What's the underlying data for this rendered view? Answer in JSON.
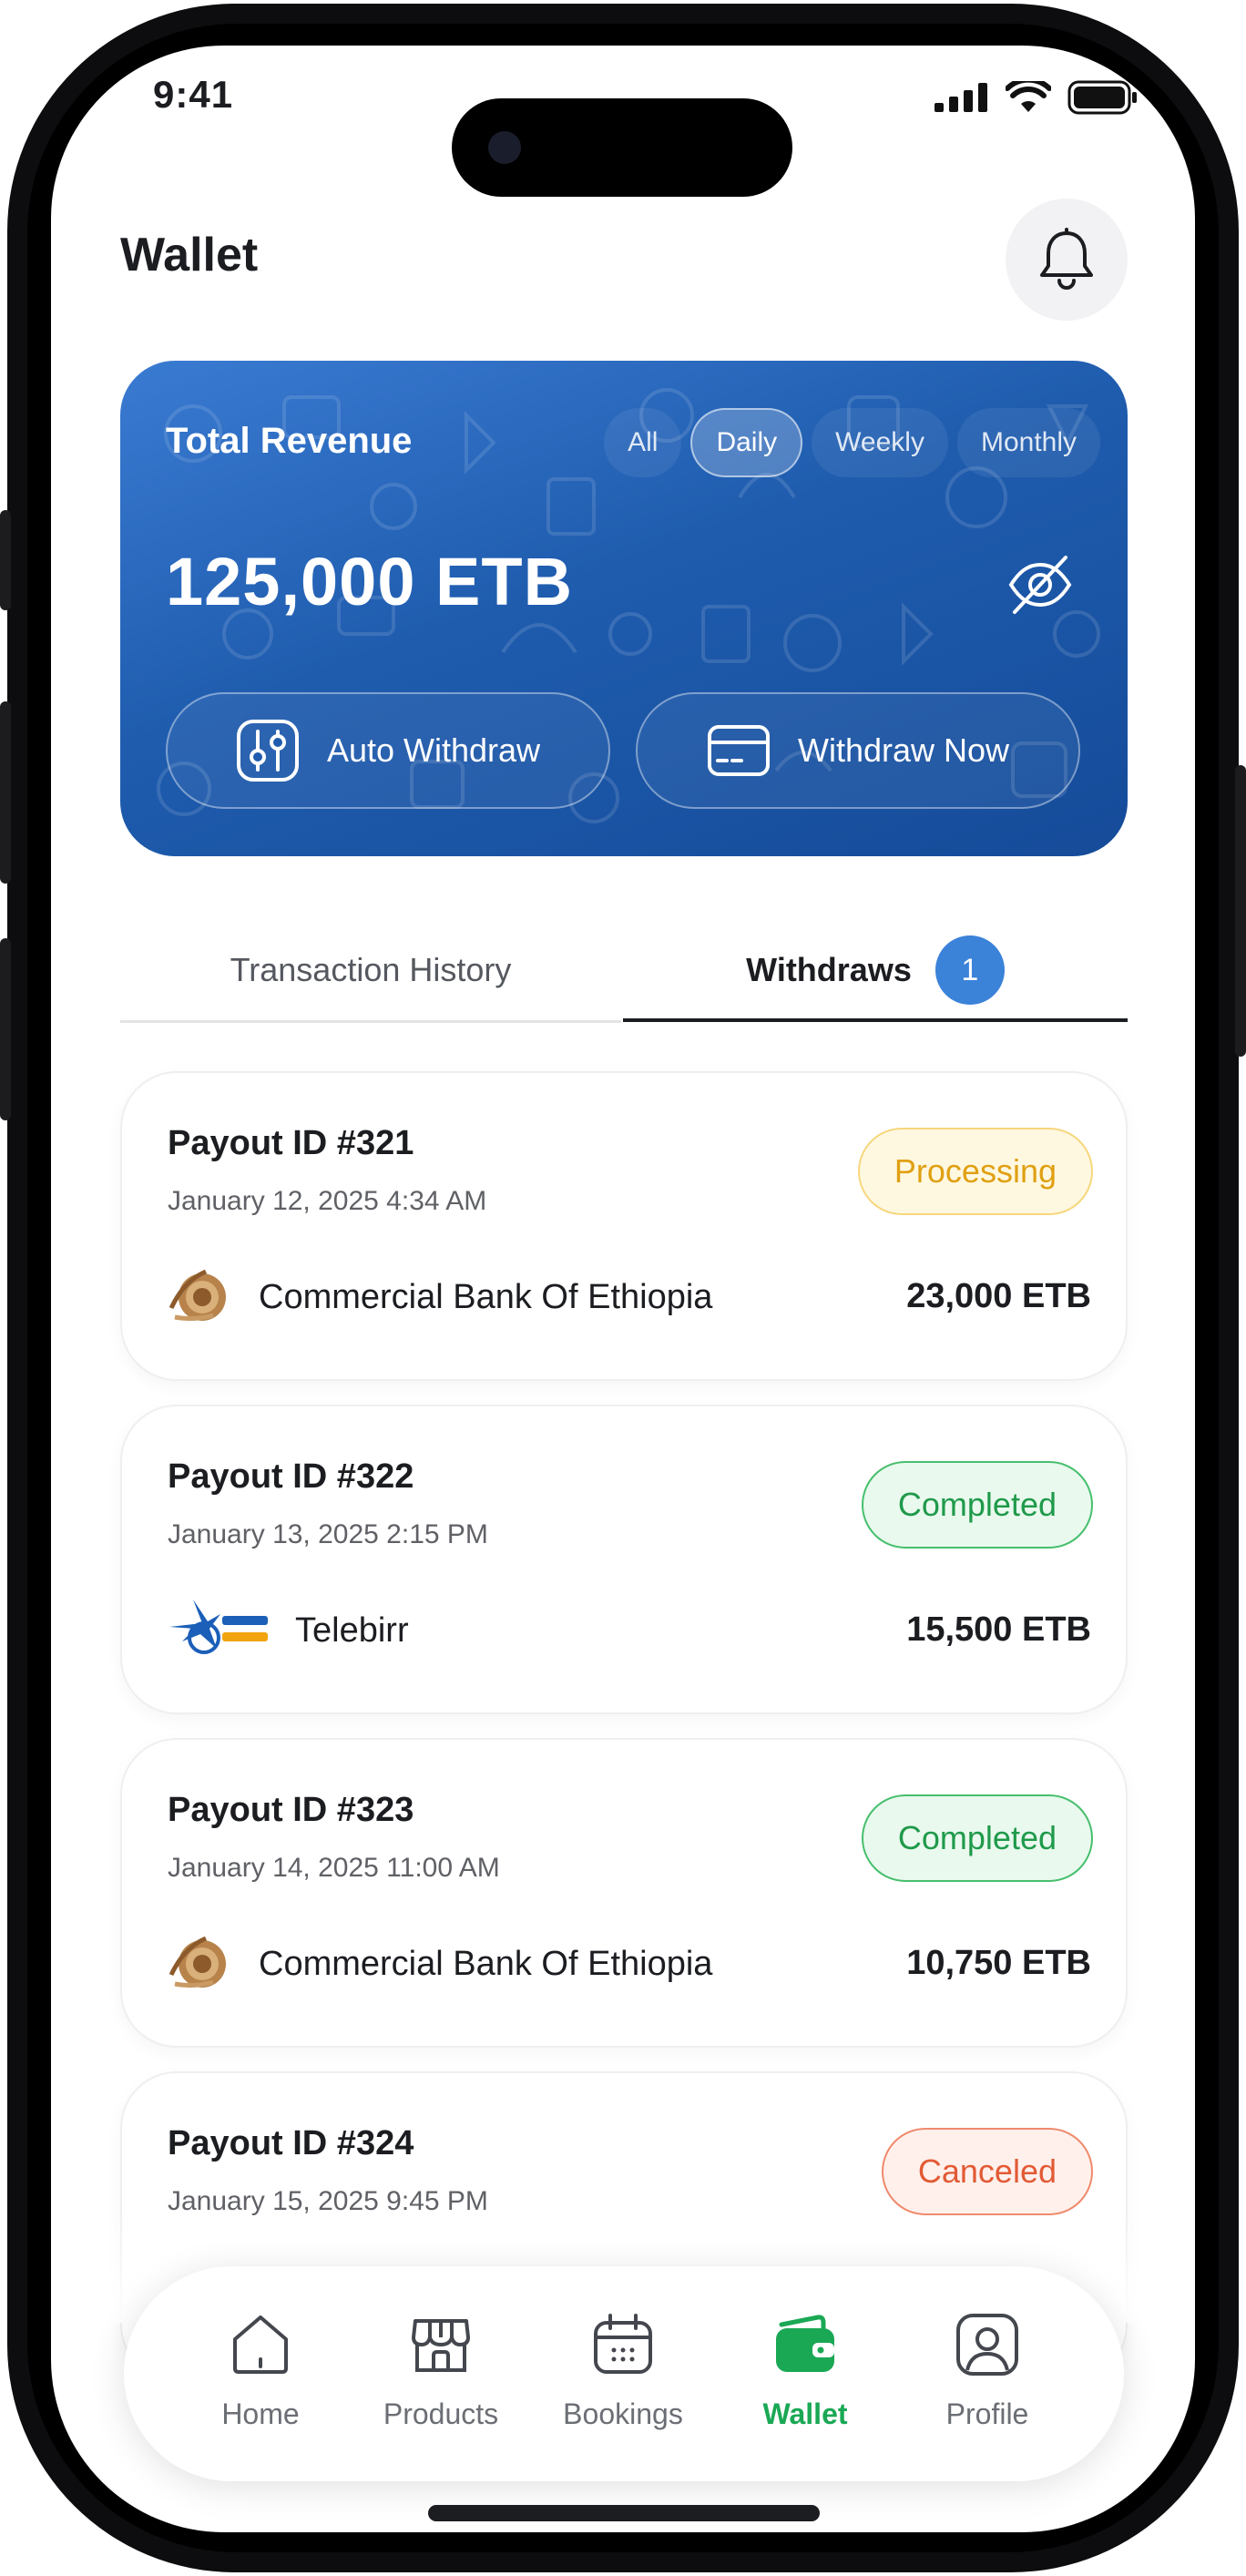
{
  "status_bar": {
    "time": "9:41"
  },
  "header": {
    "title": "Wallet"
  },
  "revenue": {
    "label": "Total Revenue",
    "periods": [
      "All",
      "Daily",
      "Weekly",
      "Monthly"
    ],
    "active_period": "Daily",
    "amount": "125,000 ETB",
    "auto_withdraw_label": "Auto Withdraw",
    "withdraw_now_label": "Withdraw Now"
  },
  "tabs": {
    "history_label": "Transaction History",
    "withdraws_label": "Withdraws",
    "withdraws_count": "1",
    "active": "Withdraws"
  },
  "payouts": [
    {
      "id": "Payout ID #321",
      "date": "January 12, 2025 4:34 AM",
      "status": "Processing",
      "status_type": "processing",
      "bank": "Commercial Bank Of Ethiopia",
      "bank_logo": "cbe-logo",
      "amount": "23,000 ETB"
    },
    {
      "id": "Payout ID #322",
      "date": "January 13, 2025 2:15 PM",
      "status": "Completed",
      "status_type": "completed",
      "bank": "Telebirr",
      "bank_logo": "telebirr-logo",
      "amount": "15,500 ETB"
    },
    {
      "id": "Payout ID #323",
      "date": "January 14, 2025 11:00 AM",
      "status": "Completed",
      "status_type": "completed",
      "bank": "Commercial Bank Of Ethiopia",
      "bank_logo": "cbe-logo",
      "amount": "10,750 ETB"
    },
    {
      "id": "Payout ID #324",
      "date": "January 15, 2025 9:45 PM",
      "status": "Canceled",
      "status_type": "canceled",
      "bank": "",
      "bank_logo": "",
      "amount": ""
    }
  ],
  "nav": {
    "items": [
      {
        "label": "Home",
        "icon": "home-icon"
      },
      {
        "label": "Products",
        "icon": "store-icon"
      },
      {
        "label": "Bookings",
        "icon": "calendar-icon"
      },
      {
        "label": "Wallet",
        "icon": "wallet-icon"
      },
      {
        "label": "Profile",
        "icon": "profile-icon"
      }
    ],
    "active": "Wallet"
  },
  "colors": {
    "card_gradient_start": "#3a7bd2",
    "card_gradient_end": "#154b99",
    "accent_green": "#1aa855",
    "badge_blue": "#3b82d9",
    "processing": "#e0a012",
    "completed": "#1f9a4a",
    "canceled": "#e25a34"
  }
}
